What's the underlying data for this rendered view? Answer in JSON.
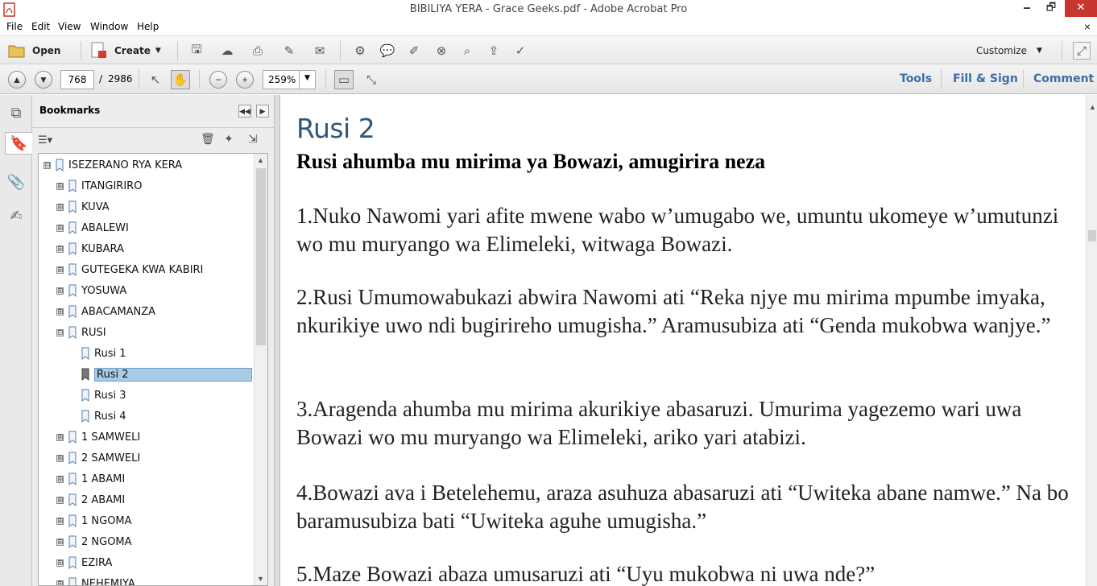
{
  "window": {
    "title": "BIBILIYA YERA - Grace Geeks.pdf - Adobe Acrobat Pro",
    "minimize": "🗕",
    "restore": "🗗",
    "close": "✕"
  },
  "menubar": {
    "items": [
      "File",
      "Edit",
      "View",
      "Window",
      "Help"
    ],
    "close_glyph": "×"
  },
  "toolbar": {
    "open_label": "Open",
    "create_label": "Create",
    "customize_label": "Customize",
    "icons": [
      "save-icon",
      "upload-icon",
      "print-icon",
      "sign-icon",
      "email-icon",
      "settings-icon",
      "comment-icon",
      "highlight-icon",
      "delete-page-icon",
      "sticky-icon",
      "export-icon",
      "form-icon"
    ]
  },
  "navigation": {
    "current_page": "768",
    "page_separator": "/",
    "total_pages": "2986",
    "zoom": "259%"
  },
  "panes": {
    "tools": "Tools",
    "fill_sign": "Fill & Sign",
    "comment": "Comment"
  },
  "bookmarks": {
    "panel_title": "Bookmarks",
    "items": [
      {
        "label": "ISEZERANO RYA KERA",
        "expander": "⊟"
      },
      {
        "label": "ITANGIRIRO",
        "expander": "⊞"
      },
      {
        "label": "KUVA",
        "expander": "⊞"
      },
      {
        "label": "ABALEWI",
        "expander": "⊞"
      },
      {
        "label": "KUBARA",
        "expander": "⊞"
      },
      {
        "label": "GUTEGEKA KWA KABIRI",
        "expander": "⊞"
      },
      {
        "label": "YOSUWA",
        "expander": "⊞"
      },
      {
        "label": "ABACAMANZA",
        "expander": "⊞"
      },
      {
        "label": "RUSI",
        "expander": "⊟"
      },
      {
        "label": "Rusi 1",
        "expander": ""
      },
      {
        "label": "Rusi 2",
        "expander": ""
      },
      {
        "label": "Rusi 3",
        "expander": ""
      },
      {
        "label": "Rusi 4",
        "expander": ""
      },
      {
        "label": "1 SAMWELI",
        "expander": "⊞"
      },
      {
        "label": "2 SAMWELI",
        "expander": "⊞"
      },
      {
        "label": "1 ABAMI",
        "expander": "⊞"
      },
      {
        "label": "2 ABAMI",
        "expander": "⊞"
      },
      {
        "label": "1 NGOMA",
        "expander": "⊞"
      },
      {
        "label": "2 NGOMA",
        "expander": "⊞"
      },
      {
        "label": "EZIRA",
        "expander": "⊞"
      },
      {
        "label": "NEHEMIYA",
        "expander": "⊞"
      }
    ],
    "selected_label": "Rusi 2"
  },
  "document": {
    "chapter_title": "Rusi 2",
    "subtitle": "Rusi ahumba mu mirima ya Bowazi, amugirira neza",
    "verses": [
      "1.Nuko Nawomi yari afite mwene wabo w’umugabo we, umuntu ukomeye w’umutunzi wo mu muryango wa Elimeleki, witwaga Bowazi.",
      "2.Rusi Umumowabukazi abwira Nawomi ati “Reka njye mu mirima mpumbe imyaka, nkurikiye uwo ndi bugirireho umugisha.” Aramusubiza ati “Genda mukobwa wanjye.”",
      "3.Aragenda ahumba mu mirima akurikiye abasaruzi. Umurima yagezemo wari uwa Bowazi wo mu muryango wa Elimeleki, ariko yari atabizi.",
      "4.Bowazi ava i Betelehemu, araza asuhuza abasaruzi ati “Uwiteka abane namwe.” Na bo baramusubiza bati “Uwiteka aguhe umugisha.”",
      "5.Maze Bowazi abaza umusaruzi ati “Uyu mukobwa ni uwa nde?”"
    ]
  },
  "colors": {
    "accent": "#3b6ea5",
    "chapter_title": "#2f5777",
    "selection": "#a9cbe6",
    "close_red": "#c7372f"
  }
}
